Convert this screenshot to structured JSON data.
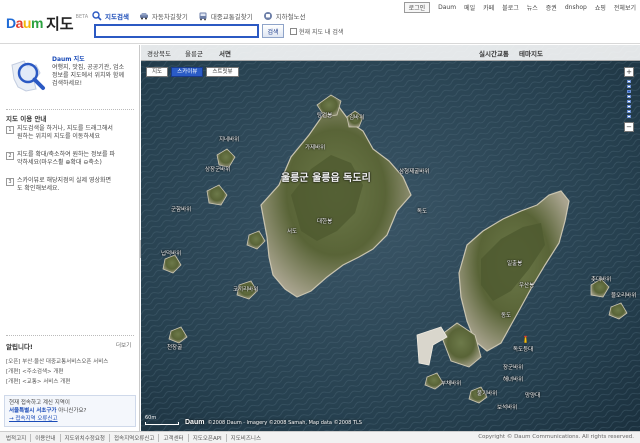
{
  "header": {
    "app_title": "지도",
    "beta_label": "BETA",
    "logo_text": [
      "D",
      "a",
      "u",
      "m"
    ],
    "tabs": [
      {
        "label": "지도검색",
        "icon": "magnifier-icon",
        "active": true
      },
      {
        "label": "자동차길찾기",
        "icon": "car-icon",
        "active": false
      },
      {
        "label": "대중교통길찾기",
        "icon": "bus-icon",
        "active": false
      },
      {
        "label": "지하철노선",
        "icon": "subway-icon",
        "active": false
      }
    ],
    "search": {
      "value": "",
      "placeholder": "",
      "button_label": "검색",
      "within_map_label": "현재 지도 내 검색"
    },
    "topnav": [
      "로그인",
      "Daum",
      "메일",
      "카페",
      "블로그",
      "뉴스",
      "증권",
      "dnshop",
      "쇼핑",
      "전체보기"
    ]
  },
  "sidebar": {
    "intro_title": "Daum 지도",
    "intro_lines": [
      "여행지, 맛집, 공공기관, 업소",
      "정보를 지도에서 위치와 함께",
      "검색하세요!"
    ],
    "guide_title": "지도 이용 안내",
    "guides": [
      {
        "num": "1",
        "lines": [
          "지도검색을 하거나, 지도를 드래그해서",
          "원하는 위치의 지도를 이동하세요"
        ]
      },
      {
        "num": "2",
        "lines": [
          "지도를 확대/축소하여 원하는 정보를 파",
          "악하세요(마우스휠 ⊕확대 ⊖축소)"
        ]
      },
      {
        "num": "3",
        "lines": [
          "스카이뷰로 해당지점의 실제 영상화면",
          "도 확인해보세요."
        ]
      }
    ],
    "notice_title": "알립니다!",
    "notice_more": "더보기",
    "notices": [
      "[오픈] 부산·울산 대중교통서비스오픈 서비스",
      "[개편] <주소검색> 개편",
      "[개편] <교통> 서비스 개편"
    ],
    "alert": {
      "prefix": "현재 접속하고 계신 지역이",
      "region": "서울특별시 서초구가",
      "suffix": " 아니신가요?",
      "link": "→ 접속지역 오류신고"
    }
  },
  "map": {
    "toolbar": {
      "crumbs": [
        "경상북도",
        "울릉군",
        "서면"
      ],
      "live_traffic": "실시간교통",
      "theme_map": "테마지도"
    },
    "map_types": [
      {
        "label": "지도",
        "active": false
      },
      {
        "label": "스카이뷰",
        "active": true
      },
      {
        "label": "스트릿뷰",
        "active": false
      }
    ],
    "zoom": {
      "plus": "+",
      "minus": "−",
      "current_level": 3,
      "levels": 10
    },
    "labels": [
      {
        "text": "울릉군 울릉읍 독도리",
        "big": true
      },
      {
        "text": "탕건봉"
      },
      {
        "text": "김바위"
      },
      {
        "text": "지네바위"
      },
      {
        "text": "가제바위"
      },
      {
        "text": "삼형제굴바위"
      },
      {
        "text": "상장군바위"
      },
      {
        "text": "군함바위"
      },
      {
        "text": "대한봉"
      },
      {
        "text": "서도"
      },
      {
        "text": "독도"
      },
      {
        "text": "넙덕바위"
      },
      {
        "text": "코끼리바위"
      },
      {
        "text": "일출봉"
      },
      {
        "text": "우산봉"
      },
      {
        "text": "동도"
      },
      {
        "text": "독도등대"
      },
      {
        "text": "촛대바위"
      },
      {
        "text": "물오리바위"
      },
      {
        "text": "장군바위"
      },
      {
        "text": "해녀바위"
      },
      {
        "text": "부채바위"
      },
      {
        "text": "불기바위"
      },
      {
        "text": "보석바위"
      },
      {
        "text": "망양대"
      },
      {
        "text": "천장굴"
      }
    ],
    "scale": "60m",
    "copyright": "©2008 Daum · Imagery ©2008 Samah, Map data ©2008 TLS"
  },
  "footer": {
    "links": [
      "법적고지",
      "이용안내",
      "지도위치수정요청",
      "접속지역오류신고",
      "고객센터",
      "지도오픈API",
      "지도비즈니스"
    ],
    "copyright": "Copyright © Daum Communications. All rights reserved."
  }
}
